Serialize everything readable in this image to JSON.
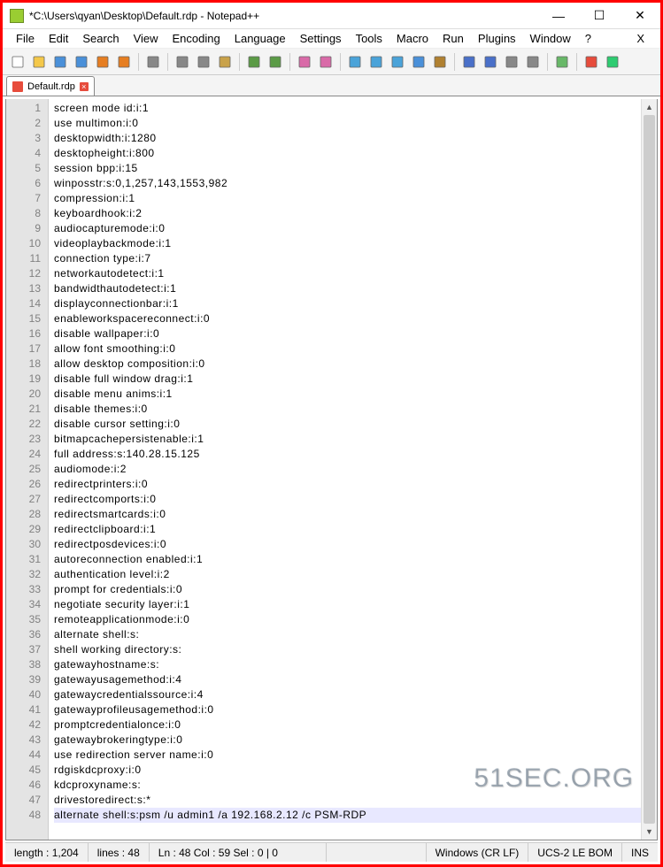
{
  "window": {
    "title": "*C:\\Users\\qyan\\Desktop\\Default.rdp - Notepad++"
  },
  "menu": {
    "items": [
      "File",
      "Edit",
      "Search",
      "View",
      "Encoding",
      "Language",
      "Settings",
      "Tools",
      "Macro",
      "Run",
      "Plugins",
      "Window",
      "?"
    ],
    "extra": "X"
  },
  "tab": {
    "label": "Default.rdp"
  },
  "lines": [
    "screen mode id:i:1",
    "use multimon:i:0",
    "desktopwidth:i:1280",
    "desktopheight:i:800",
    "session bpp:i:15",
    "winposstr:s:0,1,257,143,1553,982",
    "compression:i:1",
    "keyboardhook:i:2",
    "audiocapturemode:i:0",
    "videoplaybackmode:i:1",
    "connection type:i:7",
    "networkautodetect:i:1",
    "bandwidthautodetect:i:1",
    "displayconnectionbar:i:1",
    "enableworkspacereconnect:i:0",
    "disable wallpaper:i:0",
    "allow font smoothing:i:0",
    "allow desktop composition:i:0",
    "disable full window drag:i:1",
    "disable menu anims:i:1",
    "disable themes:i:0",
    "disable cursor setting:i:0",
    "bitmapcachepersistenable:i:1",
    "full address:s:140.28.15.125",
    "audiomode:i:2",
    "redirectprinters:i:0",
    "redirectcomports:i:0",
    "redirectsmartcards:i:0",
    "redirectclipboard:i:1",
    "redirectposdevices:i:0",
    "autoreconnection enabled:i:1",
    "authentication level:i:2",
    "prompt for credentials:i:0",
    "negotiate security layer:i:1",
    "remoteapplicationmode:i:0",
    "alternate shell:s:",
    "shell working directory:s:",
    "gatewayhostname:s:",
    "gatewayusagemethod:i:4",
    "gatewaycredentialssource:i:4",
    "gatewayprofileusagemethod:i:0",
    "promptcredentialonce:i:0",
    "gatewaybrokeringtype:i:0",
    "use redirection server name:i:0",
    "rdgiskdcproxy:i:0",
    "kdcproxyname:s:",
    "drivestoredirect:s:*",
    "alternate shell:s:psm /u admin1 /a 192.168.2.12 /c PSM-RDP"
  ],
  "highlight_line": 48,
  "status": {
    "length": "length : 1,204",
    "lines": "lines : 48",
    "pos": "Ln : 48    Col : 59    Sel : 0 | 0",
    "eol": "Windows (CR LF)",
    "enc": "UCS-2 LE BOM",
    "ins": "INS"
  },
  "watermark": "51SEC.ORG",
  "icons": {
    "toolbar": [
      "new",
      "open",
      "save",
      "saveall",
      "close",
      "closeall",
      "print",
      "cut",
      "copy",
      "paste",
      "undo",
      "redo",
      "find",
      "replace",
      "zoomin",
      "zoomout",
      "sync",
      "wrap",
      "allchars",
      "indent",
      "outdent",
      "fold",
      "unfold",
      "hide",
      "record",
      "play"
    ]
  },
  "colors": {
    "accent": "#ff0000",
    "highlight": "#e8e8ff"
  }
}
